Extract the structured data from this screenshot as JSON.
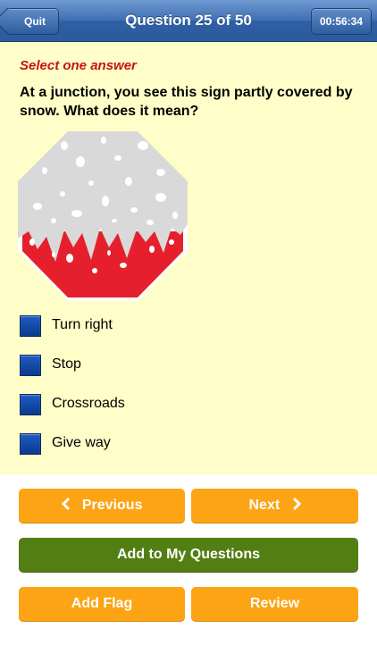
{
  "header": {
    "quit_label": "Quit",
    "title": "Question 25 of 50",
    "timer": "00:56:34"
  },
  "question": {
    "instruction": "Select one answer",
    "text": "At a junction, you see this sign partly covered by snow. What does it mean?",
    "image_icon": "snow-covered-octagon-sign",
    "options": [
      {
        "label": "Turn right"
      },
      {
        "label": "Stop"
      },
      {
        "label": "Crossroads"
      },
      {
        "label": "Give way"
      }
    ]
  },
  "buttons": {
    "previous": "Previous",
    "next": "Next",
    "add_to_my_questions": "Add to My Questions",
    "add_flag": "Add Flag",
    "review": "Review"
  },
  "colors": {
    "nav_bar": "#3f6fb3",
    "question_bg": "#fffdc8",
    "instruction_red": "#c81414",
    "orange_button": "#fda414",
    "green_button": "#527e13",
    "checkbox_blue": "#0b3a8d",
    "sign_red": "#e5202c"
  }
}
